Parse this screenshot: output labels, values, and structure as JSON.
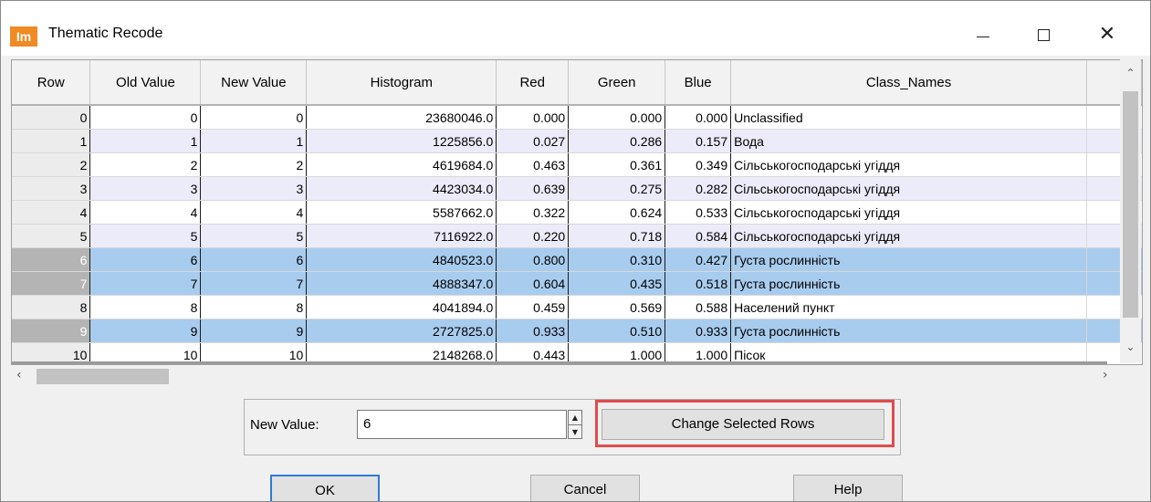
{
  "window": {
    "app_icon_text": "Im",
    "title": "Thematic Recode"
  },
  "table": {
    "columns": [
      "Row",
      "Old Value",
      "New Value",
      "Histogram",
      "Red",
      "Green",
      "Blue",
      "Class_Names"
    ],
    "rows": [
      [
        "0",
        "0",
        "0",
        "23680046.0",
        "0.000",
        "0.000",
        "0.000",
        "Unclassified"
      ],
      [
        "1",
        "1",
        "1",
        "1225856.0",
        "0.027",
        "0.286",
        "0.157",
        "Вода"
      ],
      [
        "2",
        "2",
        "2",
        "4619684.0",
        "0.463",
        "0.361",
        "0.349",
        "Сільськогосподарські угіддя"
      ],
      [
        "3",
        "3",
        "3",
        "4423034.0",
        "0.639",
        "0.275",
        "0.282",
        "Сільськогосподарські угіддя"
      ],
      [
        "4",
        "4",
        "4",
        "5587662.0",
        "0.322",
        "0.624",
        "0.533",
        "Сільськогосподарські угіддя"
      ],
      [
        "5",
        "5",
        "5",
        "7116922.0",
        "0.220",
        "0.718",
        "0.584",
        "Сільськогосподарські угіддя"
      ],
      [
        "6",
        "6",
        "6",
        "4840523.0",
        "0.800",
        "0.310",
        "0.427",
        "Густа рослинність"
      ],
      [
        "7",
        "7",
        "7",
        "4888347.0",
        "0.604",
        "0.435",
        "0.518",
        "Густа рослинність"
      ],
      [
        "8",
        "8",
        "8",
        "4041894.0",
        "0.459",
        "0.569",
        "0.588",
        "Населений пункт"
      ],
      [
        "9",
        "9",
        "9",
        "2727825.0",
        "0.933",
        "0.510",
        "0.933",
        "Густа рослинність"
      ],
      [
        "10",
        "10",
        "10",
        "2148268.0",
        "0.443",
        "1.000",
        "1.000",
        "Пісок"
      ]
    ],
    "selected_rows": [
      6,
      7,
      9
    ]
  },
  "controls": {
    "new_value_label": "New Value:",
    "new_value": "6",
    "change_button": "Change Selected Rows",
    "ok_button": "OK",
    "cancel_button": "Cancel",
    "help_button": "Help"
  },
  "colors": {
    "selection": "#a8ccee",
    "alt_row": "#ecebfa",
    "highlight_border": "#e04c4c",
    "app_icon": "#f08a24"
  }
}
